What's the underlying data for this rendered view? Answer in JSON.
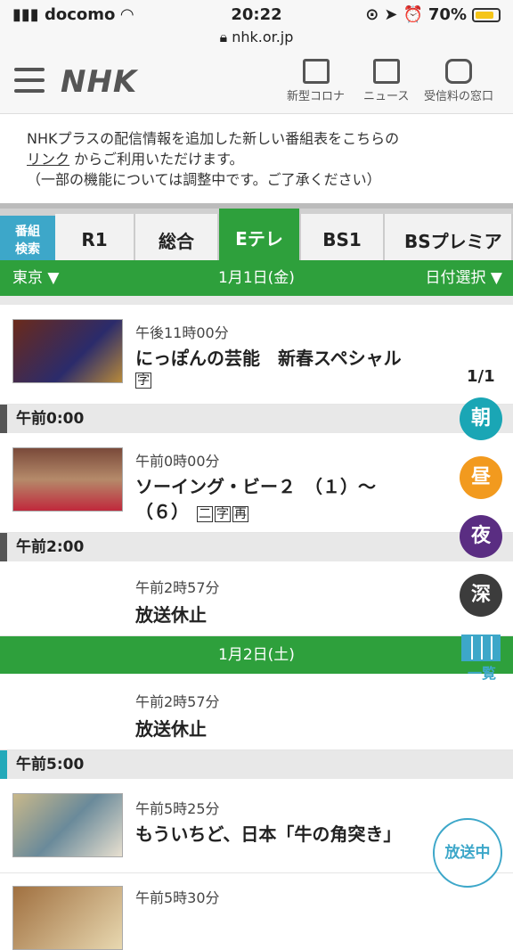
{
  "status": {
    "carrier": "docomo",
    "time": "20:22",
    "battery": "70%",
    "url": "nhk.or.jp"
  },
  "header": {
    "logo": "NHK",
    "icons": [
      {
        "label": "新型コロナ",
        "icon": "corona-icon"
      },
      {
        "label": "ニュース",
        "icon": "news-icon"
      },
      {
        "label": "受信料の窓口",
        "icon": "fee-icon"
      }
    ]
  },
  "notice": {
    "line1": "NHKプラスの配信情報を追加した新しい番組表をこちらの",
    "link": "リンク",
    "line2rest": " からご利用いただけます。",
    "line3": "（一部の機能については調整中です。ご了承ください）"
  },
  "tabs": {
    "search": [
      "番組",
      "検索"
    ],
    "items": [
      "R1",
      "総合",
      "Eテレ",
      "BS1",
      "BSプレミア"
    ],
    "active": "Eテレ"
  },
  "datebar": {
    "region": "東京 ▼",
    "date": "1月1日(金)",
    "picker": "日付選択 ▼"
  },
  "page_indicator": "1/1",
  "programs": [
    {
      "time": "午後11時00分",
      "title": "にっぽんの芸能　新春スペシャル",
      "badges": [
        "字"
      ]
    },
    {
      "time": "午前0時00分",
      "title1": "ソーイング・ビー２　（１）～",
      "title2": "（６）",
      "badges": [
        "二",
        "字",
        "再"
      ]
    },
    {
      "time": "午前2時57分",
      "title": "放送休止"
    },
    {
      "time": "午前2時57分",
      "title": "放送休止"
    },
    {
      "time": "午前5時25分",
      "title": "もういちど、日本「牛の角突き」"
    },
    {
      "time": "午前5時30分"
    }
  ],
  "time_headers": [
    "午前0:00",
    "午前2:00",
    "午前5:00"
  ],
  "date2": "1月2日(土)",
  "side_buttons": [
    {
      "label": "朝",
      "color": "#1aa6b5"
    },
    {
      "label": "昼",
      "color": "#f29a1e"
    },
    {
      "label": "夜",
      "color": "#5a2d82"
    },
    {
      "label": "深",
      "color": "#3c3c3c"
    }
  ],
  "list_label": "一覧",
  "onair_label": "放送中"
}
